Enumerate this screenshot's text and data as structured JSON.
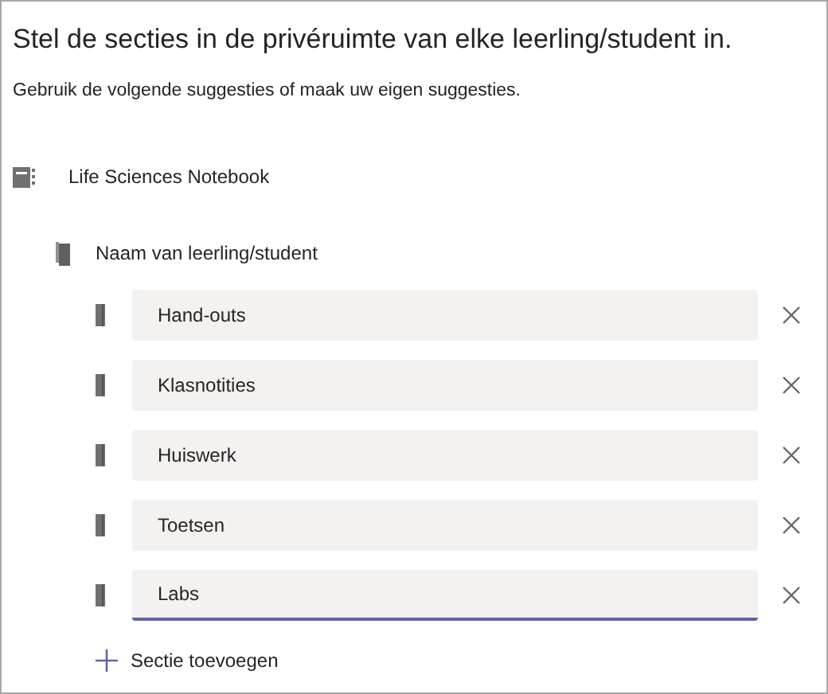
{
  "title": "Stel de secties in de privéruimte van elke leerling/student in.",
  "subtitle": "Gebruik de volgende suggesties of maak uw eigen suggesties.",
  "notebook": {
    "name": "Life Sciences Notebook"
  },
  "student": {
    "name": "Naam van leerling/student"
  },
  "sections": [
    {
      "value": "Hand-outs",
      "focused": false
    },
    {
      "value": "Klasnotities",
      "focused": false
    },
    {
      "value": "Huiswerk",
      "focused": false
    },
    {
      "value": "Toetsen",
      "focused": false
    },
    {
      "value": "Labs",
      "focused": true
    }
  ],
  "add_button": "Sectie toevoegen"
}
